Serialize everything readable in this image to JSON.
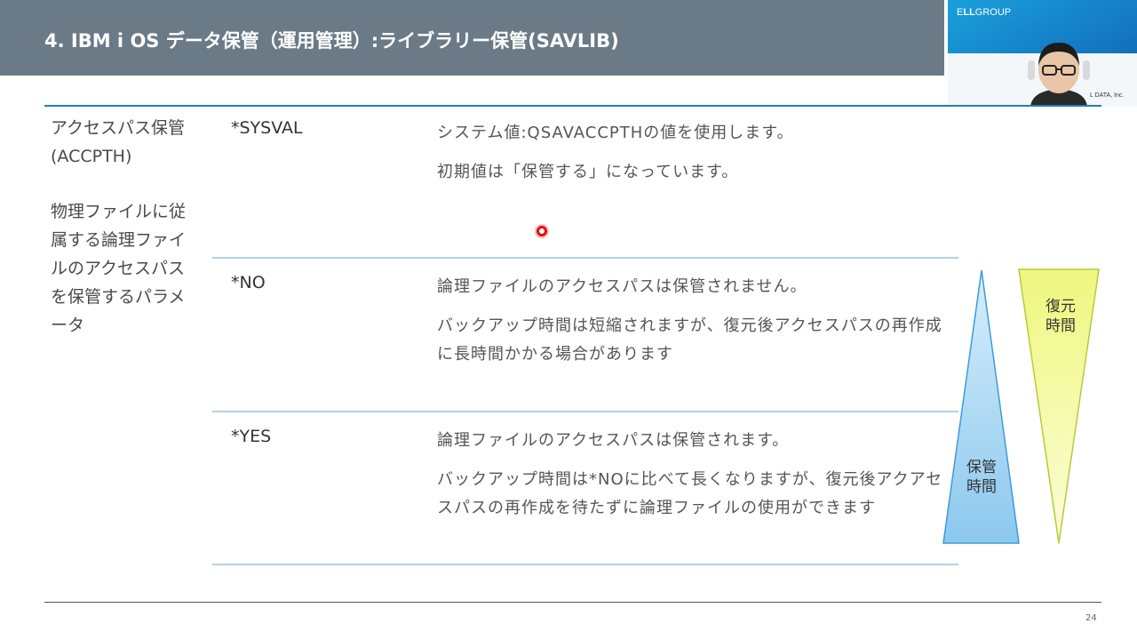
{
  "slide": {
    "title": "4. IBM i OS データ保管（運用管理）:ライブラリー保管(SAVLIB)",
    "page_number": "24"
  },
  "webcam": {
    "logo_prefix": "E",
    "logo_bold": "LL",
    "logo_rest": "GROUP",
    "caption": "L DATA, Inc."
  },
  "parameter": {
    "name_line1": "アクセスパス保管",
    "name_line2": "(ACCPTH)",
    "desc_lines": [
      "物理ファイルに従",
      "属する論理ファイ",
      "ルのアクセスパス",
      "を保管するパラメ",
      "ータ"
    ]
  },
  "options": [
    {
      "value": "*SYSVAL",
      "lines": [
        "システム値:QSAVACCPTHの値を使用します。",
        "初期値は「保管する」になっています。"
      ]
    },
    {
      "value": "*NO",
      "lines": [
        "論理ファイルのアクセスパスは保管されません。",
        "バックアップ時間は短縮されますが、復元後アクセスパスの再作成に長時間かかる場合があります"
      ]
    },
    {
      "value": "*YES",
      "lines": [
        "論理ファイルのアクセスパスは保管されます。",
        "バックアップ時間は*NOに比べて長くなりますが、復元後アクアセスパスの再作成を待たずに論理ファイルの使用ができます"
      ]
    }
  ],
  "diagram": {
    "backup_label_line1": "保管",
    "backup_label_line2": "時間",
    "restore_label_line1": "復元",
    "restore_label_line2": "時間",
    "backup_color": "#a8d8f4",
    "restore_color": "#f0f7a0"
  }
}
